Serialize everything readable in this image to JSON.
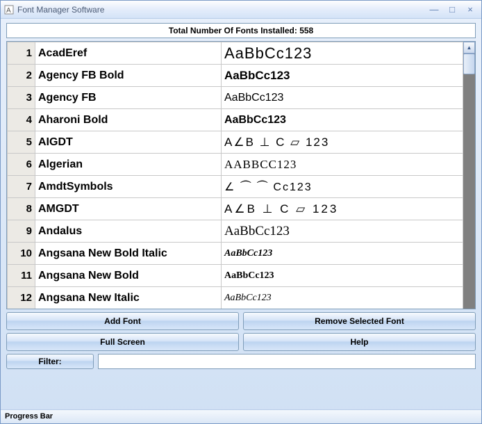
{
  "window": {
    "title": "Font Manager Software"
  },
  "header": {
    "text": "Total Number Of Fonts Installed: 558"
  },
  "fonts": [
    {
      "n": "1",
      "name": "AcadEref",
      "sample": "AaBbCc123",
      "style": "font-family:Arial;font-size:22px;letter-spacing:1px;"
    },
    {
      "n": "2",
      "name": "Agency FB Bold",
      "sample": "AaBbCc123",
      "style": "font-family:'Arial Narrow',Arial;font-weight:bold;font-size:17px;"
    },
    {
      "n": "3",
      "name": "Agency FB",
      "sample": "AaBbCc123",
      "style": "font-family:'Arial Narrow',Arial;font-size:16px;"
    },
    {
      "n": "4",
      "name": "Aharoni Bold",
      "sample": "AaBbCc123",
      "style": "font-family:Arial;font-weight:bold;font-size:16px;"
    },
    {
      "n": "5",
      "name": "AIGDT",
      "sample": "A∠B ⊥ C ▱ 123",
      "style": "font-family:Arial;font-size:17px;letter-spacing:2px;"
    },
    {
      "n": "6",
      "name": "Algerian",
      "sample": "AABBCC123",
      "style": "font-family:'Times New Roman',serif;font-size:17px;letter-spacing:1px;"
    },
    {
      "n": "7",
      "name": "AmdtSymbols",
      "sample": "∠ ⏜ ⏜ Cc123",
      "style": "font-family:Arial;font-size:16px;letter-spacing:2px;"
    },
    {
      "n": "8",
      "name": "AMGDT",
      "sample": "A∠B ⊥ C ▱ 123",
      "style": "font-family:Arial;font-size:17px;letter-spacing:3px;"
    },
    {
      "n": "9",
      "name": "Andalus",
      "sample": "AaBbCc123",
      "style": "font-family:'Times New Roman',serif;font-size:19px;"
    },
    {
      "n": "10",
      "name": "Angsana New Bold Italic",
      "sample": "AaBbCc123",
      "style": "font-family:'Times New Roman',serif;font-style:italic;font-weight:bold;font-size:14px;"
    },
    {
      "n": "11",
      "name": "Angsana New Bold",
      "sample": "AaBbCc123",
      "style": "font-family:'Times New Roman',serif;font-weight:bold;font-size:14px;"
    },
    {
      "n": "12",
      "name": "Angsana New Italic",
      "sample": "AaBbCc123",
      "style": "font-family:'Times New Roman',serif;font-style:italic;font-size:14px;"
    }
  ],
  "buttons": {
    "add": "Add Font",
    "remove": "Remove Selected Font",
    "fullscreen": "Full Screen",
    "help": "Help"
  },
  "filter": {
    "label": "Filter:",
    "value": ""
  },
  "status": {
    "text": "Progress Bar"
  }
}
